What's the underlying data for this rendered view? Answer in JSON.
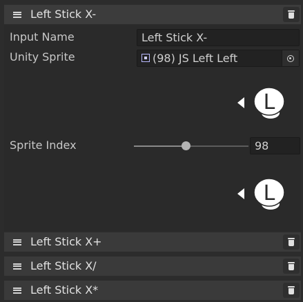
{
  "elements": [
    {
      "title": "Left Stick X-",
      "expanded": true,
      "fields": {
        "input_name_label": "Input Name",
        "input_name_value": "Left Stick X-",
        "unity_sprite_label": "Unity Sprite",
        "unity_sprite_value": "(98) JS Left Left",
        "sprite_index_label": "Sprite Index",
        "sprite_index_value": "98",
        "slider_fraction": 0.45
      },
      "preview_glyph": "L"
    },
    {
      "title": "Left Stick X+",
      "expanded": false
    },
    {
      "title": "Left Stick X/",
      "expanded": false
    },
    {
      "title": "Left Stick X*",
      "expanded": false
    }
  ],
  "icons": {
    "drag_handle": "hamburger-icon",
    "remove": "trash-icon",
    "object_picker": "object-picker-icon",
    "sprite": "sprite-icon"
  },
  "colors": {
    "background": "#2c2c2c",
    "header": "#3c3c3c",
    "field": "#222222",
    "preview_white": "#ffffff"
  }
}
